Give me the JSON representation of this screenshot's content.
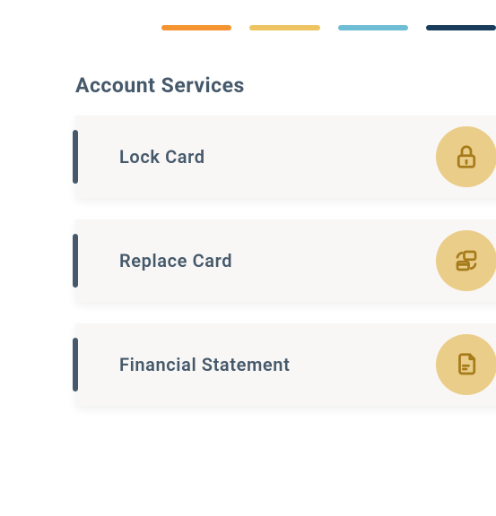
{
  "section": {
    "title": "Account Services"
  },
  "progress": {
    "colors": [
      "#f59431",
      "#edc461",
      "#6ebdd4",
      "#193c5a"
    ]
  },
  "services": [
    {
      "label": "Lock Card",
      "icon": "lock-icon"
    },
    {
      "label": "Replace Card",
      "icon": "replace-card-icon"
    },
    {
      "label": "Financial Statement",
      "icon": "document-icon"
    }
  ]
}
